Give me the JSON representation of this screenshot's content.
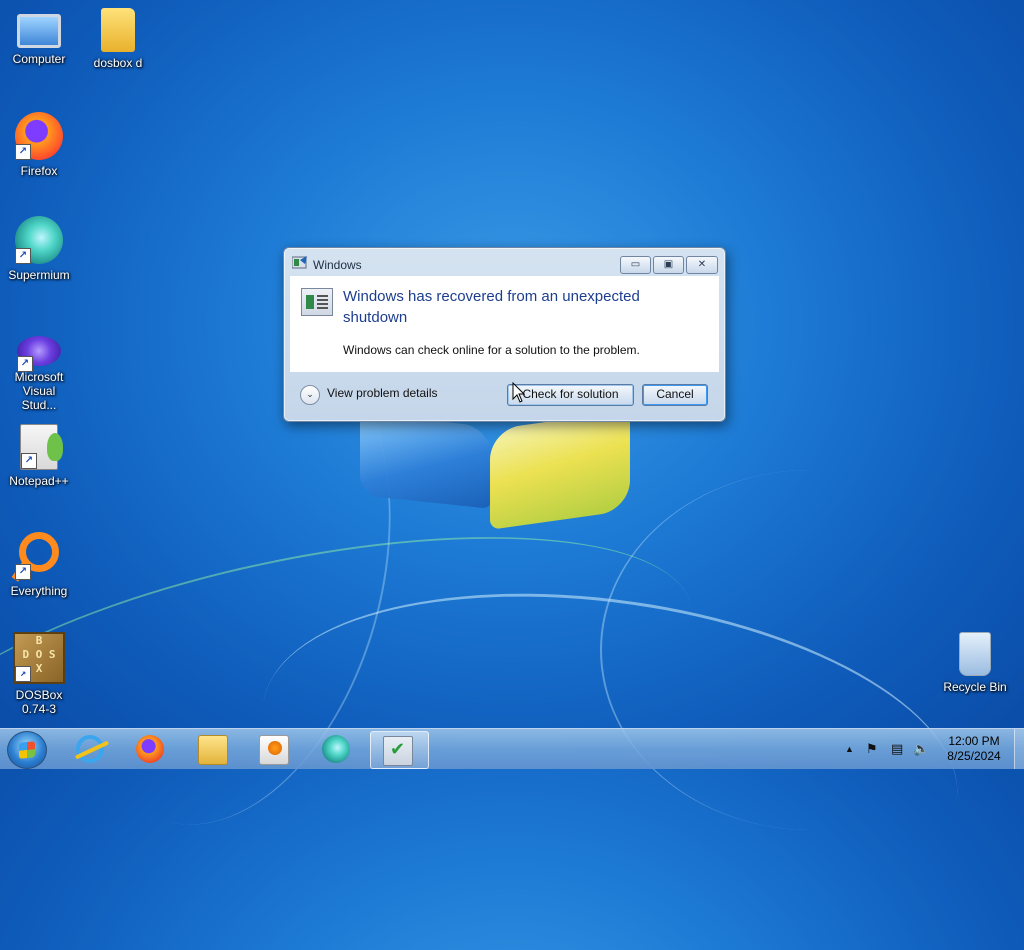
{
  "desktop": {
    "icons": [
      {
        "label": "Computer",
        "icon": "computer-icon"
      },
      {
        "label": "dosbox d",
        "icon": "folder-icon"
      },
      {
        "label": "Firefox",
        "icon": "firefox-icon"
      },
      {
        "label": "Supermium",
        "icon": "supermium-icon"
      },
      {
        "label": "Microsoft Visual Stud...",
        "icon": "visual-studio-icon"
      },
      {
        "label": "Notepad++",
        "icon": "notepad-plus-plus-icon"
      },
      {
        "label": "Everything",
        "icon": "everything-icon"
      },
      {
        "label": "DOSBox 0.74-3",
        "icon": "dosbox-icon"
      },
      {
        "label": "Recycle Bin",
        "icon": "recycle-bin-icon"
      }
    ],
    "dosbox_glyph": "B\nD O S\nX"
  },
  "dialog": {
    "title": "Windows",
    "heading": "Windows has recovered from an unexpected shutdown",
    "message": "Windows can check online for a solution to the problem.",
    "details_label": "View problem details",
    "check_label": "Check for solution",
    "cancel_label": "Cancel",
    "minimize_glyph": "▭",
    "maximize_glyph": "▣",
    "close_glyph": "✕",
    "toggle_glyph": "⌄"
  },
  "taskbar": {
    "pinned": [
      "internet-explorer-icon",
      "firefox-icon",
      "file-explorer-icon",
      "media-player-icon",
      "supermium-icon",
      "problem-reports-icon"
    ],
    "tray": {
      "show_hidden_glyph": "▲",
      "flag_glyph": "⚑",
      "network_glyph": "▤",
      "volume_glyph": "🔈"
    },
    "clock": {
      "time": "12:00 PM",
      "date": "8/25/2024"
    }
  },
  "colors": {
    "accent": "#1d3e8f",
    "desktop": "#1e7cd6"
  }
}
